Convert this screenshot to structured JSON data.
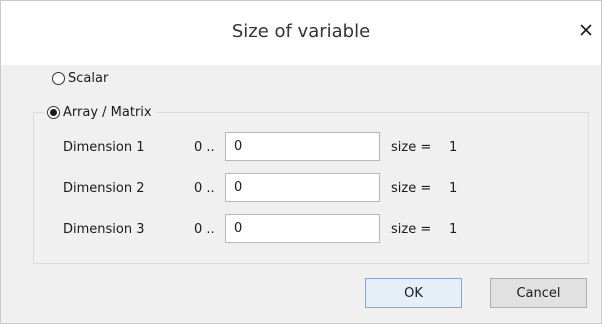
{
  "dialog": {
    "title": "Size of variable",
    "close_icon": "close-icon"
  },
  "options": {
    "scalar_label": "Scalar",
    "array_label": "Array / Matrix",
    "selected": "array"
  },
  "dimensions": [
    {
      "label": "Dimension 1",
      "range_prefix": "0 ..",
      "value": "0",
      "size_label": "size =",
      "size_value": "1"
    },
    {
      "label": "Dimension 2",
      "range_prefix": "0 ..",
      "value": "0",
      "size_label": "size =",
      "size_value": "1"
    },
    {
      "label": "Dimension 3",
      "range_prefix": "0 ..",
      "value": "0",
      "size_label": "size =",
      "size_value": "1"
    }
  ],
  "buttons": {
    "ok_label": "OK",
    "cancel_label": "Cancel"
  },
  "colors": {
    "dialog_bg": "#f0f0f0",
    "titlebar_bg": "#ffffff",
    "ok_border": "#7fa7d8",
    "ok_bg": "#e6eef8"
  }
}
